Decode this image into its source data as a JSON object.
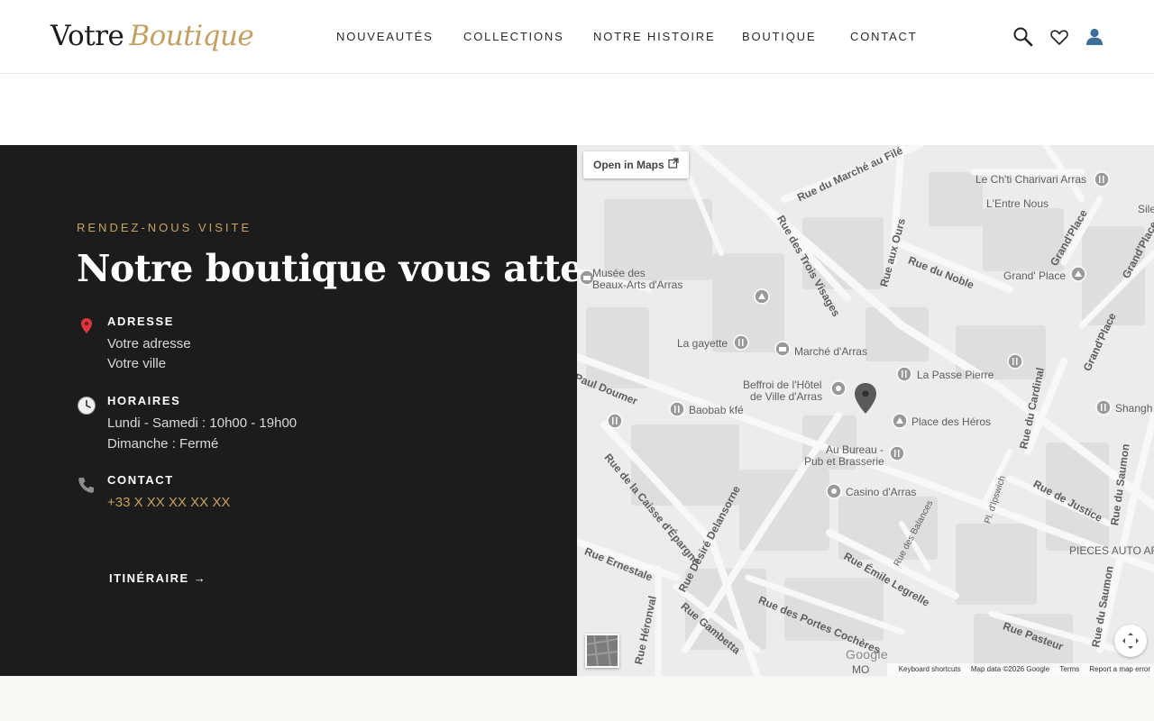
{
  "header": {
    "logo_part1": "Votre",
    "logo_part2": "Boutique",
    "nav": [
      "NOUVEAUTÉS",
      "COLLECTIONS",
      "NOTRE HISTOIRE",
      "BOUTIQUE",
      "CONTACT"
    ],
    "icons": [
      "search-icon",
      "heart-icon",
      "user-icon"
    ]
  },
  "visit": {
    "eyebrow": "RENDEZ-NOUS VISITE",
    "title": "Notre boutique vous attend",
    "address": {
      "label": "ADRESSE",
      "line1": "Votre adresse",
      "line2": "Votre ville"
    },
    "hours": {
      "label": "HORAIRES",
      "line1": "Lundi - Samedi : 10h00 - 19h00",
      "line2": "Dimanche : Fermé"
    },
    "contact": {
      "label": "CONTACT",
      "phone": "+33 X XX XX XX XX"
    },
    "route_link": "ITINÉRAIRE →"
  },
  "map": {
    "open_in_maps": "Open in Maps",
    "places": {
      "musee1": "Musée des",
      "musee2": "Beaux-Arts d'Arras",
      "la_gayette": "La gayette",
      "marche": "Marché d'Arras",
      "beffroi1": "Beffroi de l'Hôtel",
      "beffroi2": "de Ville d'Arras",
      "baobab": "Baobab kfé",
      "la_passe": "La Passe Pierre",
      "place_heros": "Place des Héros",
      "au_bureau1": "Au Bureau -",
      "au_bureau2": "Pub et Brasserie",
      "casino": "Casino d'Arras",
      "le_chti": "Le Ch'ti Charivari Arras",
      "lentre": "L'Entre Nous",
      "grand_place": "Grand' Place",
      "shangh": "Shangh",
      "pieces": "PIECES AUTO AR",
      "sile": "Sile",
      "mo": "MO"
    },
    "streets": {
      "marche_au_file": "Rue du Marché au Filé",
      "trois_visages": "Rue des Trois Visages",
      "aux_ours": "Rue aux Ours",
      "du_noble": "Rue du Noble",
      "grand_place_a": "Grand'Place",
      "grand_place_b": "Grand'Place",
      "grand_place_c": "Grand'Place",
      "paul_doumer": "Paul Doumer",
      "caisse": "Rue de la Caisse d'Épargne",
      "desire": "Rue Désiré Delansorne",
      "ernestale": "Rue Ernestale",
      "heronval": "Rue Héronval",
      "gambetta": "Rue Gambetta",
      "portes_cocheres": "Rue des Portes Cochères",
      "emile_legrelle": "Rue Émile Legrelle",
      "balances": "Rue des Balances",
      "ipswich": "Pl. d'Ipswich",
      "cardinal": "Rue du Cardinal",
      "justice": "Rue de Justice",
      "saumon_a": "Rue du Saumon",
      "saumon_b": "Rue du Saumon",
      "pasteur": "Rue Pasteur"
    },
    "footer": {
      "keyboard": "Keyboard shortcuts",
      "data": "Map data ©2026 Google",
      "terms": "Terms",
      "report": "Report a map error"
    },
    "google": "Google"
  },
  "colors": {
    "accent_gold": "#c9a35e",
    "dark_panel": "#1c1c1c",
    "map_bg": "#ebebeb"
  }
}
